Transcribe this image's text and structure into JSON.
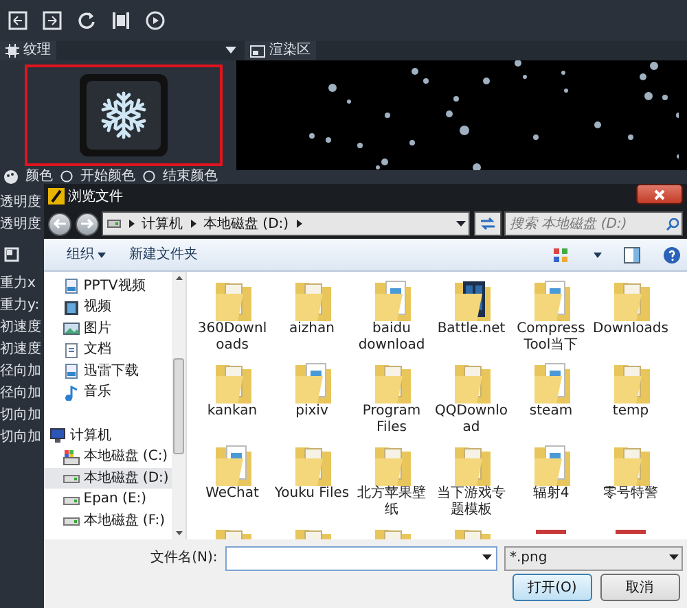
{
  "app": {
    "texture_tab": "纹理",
    "render_tab": "渲染区",
    "color_labels": [
      "颜色",
      "开始颜色",
      "结束颜色"
    ],
    "property_labels": [
      "透明度",
      "透明度"
    ],
    "motion_labels": [
      "重力x",
      "重力y:",
      "初速度",
      "初速度",
      "径向加",
      "径向加",
      "切向加",
      "切向加"
    ]
  },
  "dialog": {
    "title": "浏览文件",
    "breadcrumb": [
      "计算机",
      "本地磁盘 (D:)"
    ],
    "search": {
      "placeholder": "搜索 本地磁盘 (D:)"
    },
    "toolbar": [
      "组织",
      "新建文件夹"
    ],
    "nav": [
      {
        "label": "PPTV视频",
        "kind": "video-file",
        "selected": false
      },
      {
        "label": "视频",
        "kind": "film",
        "selected": false
      },
      {
        "label": "图片",
        "kind": "image",
        "selected": false
      },
      {
        "label": "文档",
        "kind": "doc",
        "selected": false
      },
      {
        "label": "迅雷下载",
        "kind": "video-file",
        "selected": false
      },
      {
        "label": "音乐",
        "kind": "music",
        "selected": false
      },
      {
        "label": "计算机",
        "kind": "computer",
        "selected": false,
        "group": true
      },
      {
        "label": "本地磁盘 (C:)",
        "kind": "system-drive",
        "selected": false
      },
      {
        "label": "本地磁盘 (D:)",
        "kind": "drive",
        "selected": true
      },
      {
        "label": "Epan (E:)",
        "kind": "drive",
        "selected": false
      },
      {
        "label": "本地磁盘 (F:)",
        "kind": "drive",
        "selected": false
      }
    ],
    "files": [
      {
        "name": "360Downloads",
        "kind": "folder"
      },
      {
        "name": "aizhan",
        "kind": "folder"
      },
      {
        "name": "baidu download",
        "kind": "folder-doc"
      },
      {
        "name": "Battle.net",
        "kind": "folder-dark"
      },
      {
        "name": "Compress Tool当下",
        "kind": "folder-doc"
      },
      {
        "name": "Downloads",
        "kind": "folder"
      },
      {
        "name": "kankan",
        "kind": "folder"
      },
      {
        "name": "pixiv",
        "kind": "folder-doc"
      },
      {
        "name": "Program Files",
        "kind": "folder"
      },
      {
        "name": "QQDownload",
        "kind": "folder"
      },
      {
        "name": "steam",
        "kind": "folder-doc"
      },
      {
        "name": "temp",
        "kind": "folder"
      },
      {
        "name": "WeChat",
        "kind": "folder-doc"
      },
      {
        "name": "Youku Files",
        "kind": "folder"
      },
      {
        "name": "北方苹果壁纸",
        "kind": "folder"
      },
      {
        "name": "当下游戏专题模板",
        "kind": "folder"
      },
      {
        "name": "辐射4",
        "kind": "folder-doc"
      },
      {
        "name": "零号特警",
        "kind": "folder"
      }
    ],
    "partial_files": [
      {
        "kind": "folder"
      },
      {
        "kind": "folder"
      },
      {
        "kind": "folder"
      },
      {
        "kind": "folder"
      },
      {
        "kind": "red-file"
      },
      {
        "kind": "red-file"
      }
    ],
    "file_name": {
      "label": "文件名(N):"
    },
    "filter": "*.png",
    "buttons": [
      {
        "label": "打开(O)",
        "default": true
      },
      {
        "label": "取消",
        "default": false
      }
    ]
  }
}
